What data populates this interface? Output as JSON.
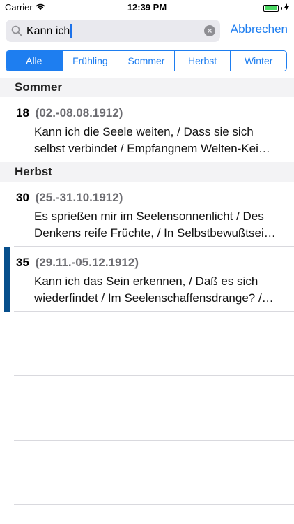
{
  "status_bar": {
    "carrier": "Carrier",
    "time": "12:39 PM"
  },
  "search": {
    "value": "Kann ich",
    "cancel_label": "Abbrechen"
  },
  "segments": [
    "Alle",
    "Frühling",
    "Sommer",
    "Herbst",
    "Winter"
  ],
  "selected_segment": "Alle",
  "sections": [
    {
      "title": "Sommer",
      "rows": [
        {
          "number": "18",
          "date": "(02.-08.08.1912)",
          "line1": "Kann ich die Seele weiten, / Dass sie sich",
          "line2": "selbst verbindet / Empfangnem Welten-Kei…"
        }
      ]
    },
    {
      "title": "Herbst",
      "rows": [
        {
          "number": "30",
          "date": "(25.-31.10.1912)",
          "line1": "Es sprießen mir im Seelensonnenlicht / Des",
          "line2": "Denkens reife Früchte, / In Selbstbewußtsei…"
        },
        {
          "number": "35",
          "date": "(29.11.-05.12.1912)",
          "line1": "Kann ich das Sein erkennen, / Daß es sich",
          "line2": "wiederfindet / Im Seelenschaffensdrange? /…"
        }
      ]
    }
  ],
  "colors": {
    "accent": "#1e7ef0",
    "highlight": "#074f8c",
    "battery": "#4cd964"
  }
}
